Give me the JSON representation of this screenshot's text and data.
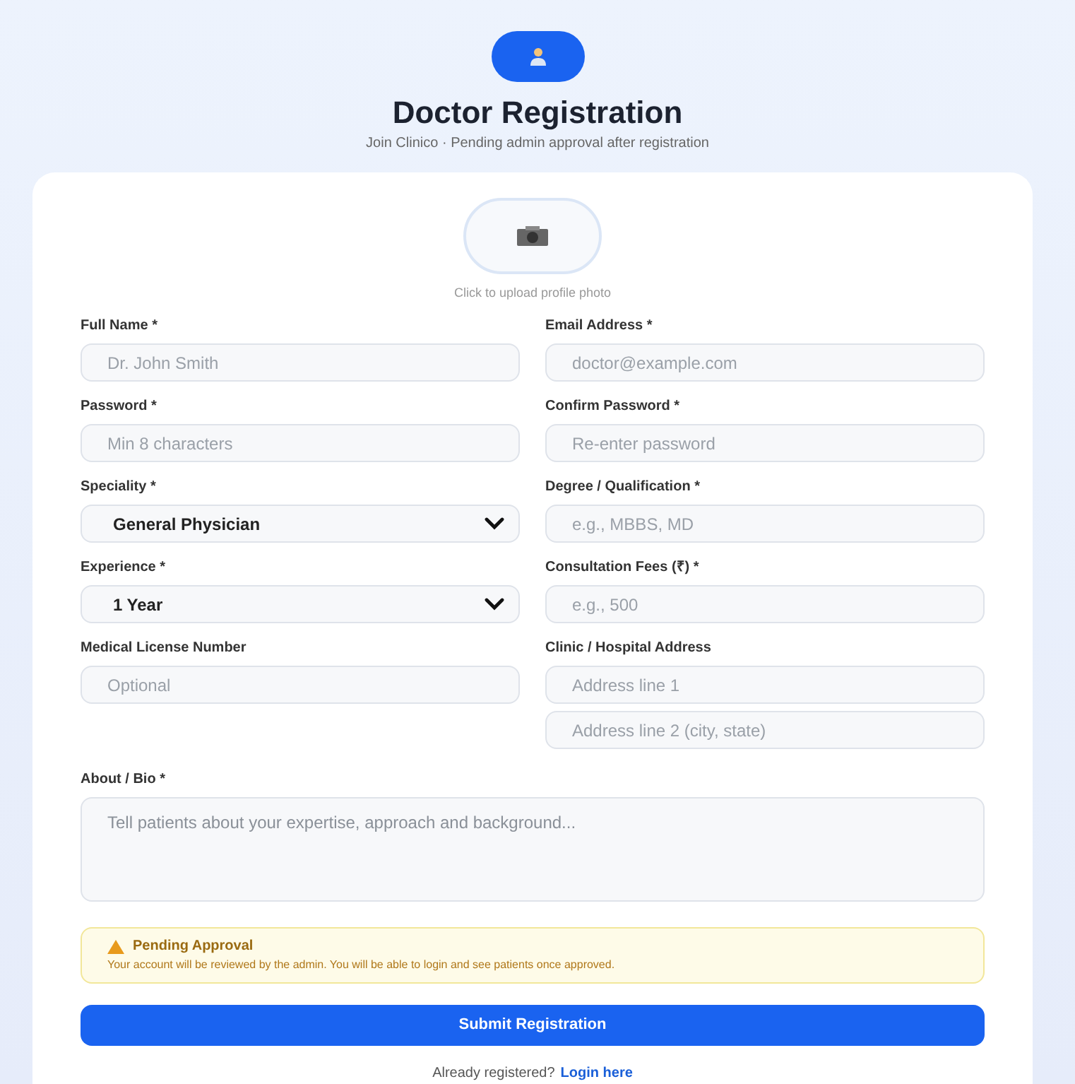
{
  "header": {
    "title": "Doctor Registration",
    "subtitle": "Join Clinico · Pending admin approval after registration"
  },
  "photo": {
    "caption": "Click to upload profile photo"
  },
  "fields": [
    {
      "label": "Full Name *",
      "kind": "text",
      "placeholder": "Dr. John Smith"
    },
    {
      "label": "Email Address *",
      "kind": "text",
      "placeholder": "doctor@example.com"
    },
    {
      "label": "Password *",
      "kind": "text",
      "placeholder": "Min 8 characters"
    },
    {
      "label": "Confirm Password *",
      "kind": "text",
      "placeholder": "Re-enter password"
    },
    {
      "label": "Speciality *",
      "kind": "select",
      "value": "General Physician"
    },
    {
      "label": "Degree / Qualification *",
      "kind": "text",
      "placeholder": "e.g., MBBS, MD"
    },
    {
      "label": "Experience *",
      "kind": "select",
      "value": "1 Year"
    },
    {
      "label": "Consultation Fees (₹) *",
      "kind": "text",
      "placeholder": "e.g., 500"
    },
    {
      "label": "Medical License Number",
      "kind": "text",
      "placeholder": "Optional"
    },
    {
      "label": "Clinic / Hospital Address",
      "kind": "stack",
      "inputs": [
        {
          "placeholder": "Address line 1"
        },
        {
          "placeholder": "Address line 2 (city, state)"
        }
      ]
    }
  ],
  "bio": {
    "label": "About / Bio *",
    "placeholder": "Tell patients about your expertise, approach and background..."
  },
  "notice": {
    "title": "Pending Approval",
    "text": "Your account will be reviewed by the admin. You will be able to login and see patients once approved."
  },
  "submit": "Submit Registration",
  "footer": {
    "text": "Already registered?",
    "link": "Login here"
  }
}
